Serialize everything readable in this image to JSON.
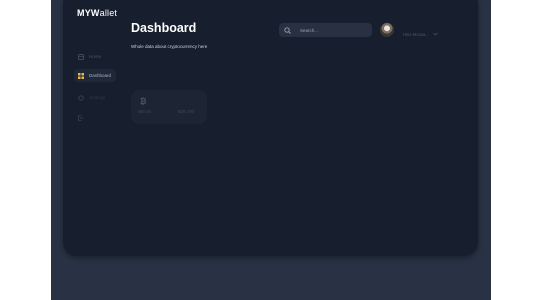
{
  "app": {
    "logo_bold": "MYW",
    "logo_thin": "allet"
  },
  "sidebar": {
    "items": [
      {
        "label": "Home",
        "icon": "home-icon"
      },
      {
        "label": "Dashboard",
        "icon": "grid-icon"
      },
      {
        "label": "Settings",
        "icon": "gear-icon"
      },
      {
        "label": "",
        "icon": "logout-icon"
      }
    ],
    "active_index": 1
  },
  "header": {
    "title": "Dashboard",
    "subtitle": "Whole data about cryptocurrency here",
    "search_placeholder": "Search...",
    "user_name": "Hina Mousa..."
  },
  "cards": [
    {
      "name": "Bitcoin",
      "symbol": "₿",
      "value": "$28.190"
    }
  ],
  "colors": {
    "background": "#171e2e",
    "accent": "#ffffff",
    "muted": "#4b5568"
  }
}
